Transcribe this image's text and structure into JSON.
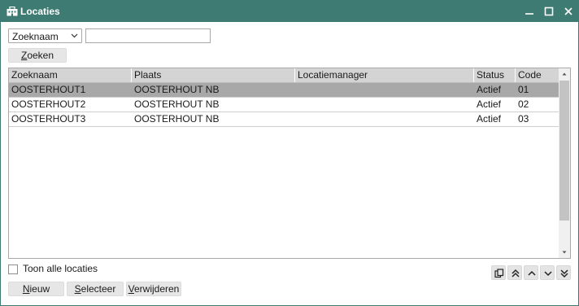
{
  "window": {
    "title": "Locaties",
    "icon": "building-icon"
  },
  "search": {
    "field_selected": "Zoeknaam",
    "value": "",
    "button_label": "Zoeken"
  },
  "table": {
    "columns": [
      "Zoeknaam",
      "Plaats",
      "Locatiemanager",
      "Status",
      "Code"
    ],
    "rows": [
      {
        "zoeknaam": "OOSTERHOUT1",
        "plaats": "OOSTERHOUT NB",
        "locatiemanager": "",
        "status": "Actief",
        "code": "01",
        "selected": true
      },
      {
        "zoeknaam": "OOSTERHOUT2",
        "plaats": "OOSTERHOUT NB",
        "locatiemanager": "",
        "status": "Actief",
        "code": "02",
        "selected": false
      },
      {
        "zoeknaam": "OOSTERHOUT3",
        "plaats": "OOSTERHOUT NB",
        "locatiemanager": "",
        "status": "Actief",
        "code": "03",
        "selected": false
      }
    ]
  },
  "options": {
    "show_all_label": "Toon alle locaties",
    "show_all_checked": false
  },
  "nav_icons": [
    "copy-icon",
    "double-chevron-up-icon",
    "chevron-up-icon",
    "chevron-down-icon",
    "double-chevron-down-icon"
  ],
  "actions": {
    "new_label": "Nieuw",
    "select_label": "Selecteer",
    "delete_label": "Verwijderen"
  },
  "colors": {
    "titlebar": "#3e7b73",
    "selected_row": "#a8a8a8",
    "header": "#d4d4d4"
  }
}
